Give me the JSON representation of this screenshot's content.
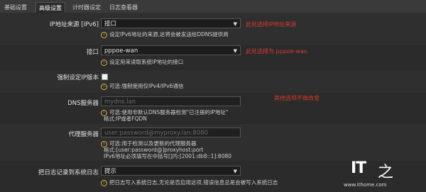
{
  "tabs": [
    "基础设置",
    "高级设置",
    "计时器设定",
    "日志查看器"
  ],
  "fields": {
    "ip_source": {
      "label": "IP地址来源 [IPv6]",
      "value": "接口",
      "hint": "设定IPv6地址的来源,这将会被发送给DDNS提供商",
      "annotation": "此处选择IP地址来源"
    },
    "interface": {
      "label": "接口",
      "value": "pppoe-wan",
      "hint": "设定用来读取系统IP地址的接口",
      "annotation": "此处选择为 pppoe-wan"
    },
    "force_ip": {
      "label": "强制设定IP版本",
      "hint": "可选:强制使用仅IPv4/IPv6通信"
    },
    "dns_server": {
      "label": "DNS服务器",
      "placeholder": "mydns.lan",
      "hint_line1": "可选:使用非默认DNS服务器检测\"已注册的IP地址\"",
      "hint_line2": "格式:IP或者FQDN",
      "annotation": "其他选项不做改变"
    },
    "proxy_server": {
      "label": "代理服务器",
      "placeholder": "user:password@myproxy.lan:8080",
      "hint_line1": "可选:用于检测以及更新的代理服务器",
      "hint_line2": "格式:[user:password@]proxyhost:port",
      "hint_line3": "IPv6地址必须填写在中括号[]内:[2001:db8::1]:8080"
    },
    "log_to_syslog": {
      "label": "把日志记录到系统日志",
      "value": "提示",
      "hint": "把日志写入系统日志,无论是否启用这项,错误信息总是会被写入系统日志"
    }
  },
  "watermark": {
    "brand": "IT之家",
    "url": "www.ithome.com"
  },
  "colors": {
    "background": "#2b2b2b",
    "annotation": "#d83a2a",
    "hint_icon": "#d6b43a"
  }
}
